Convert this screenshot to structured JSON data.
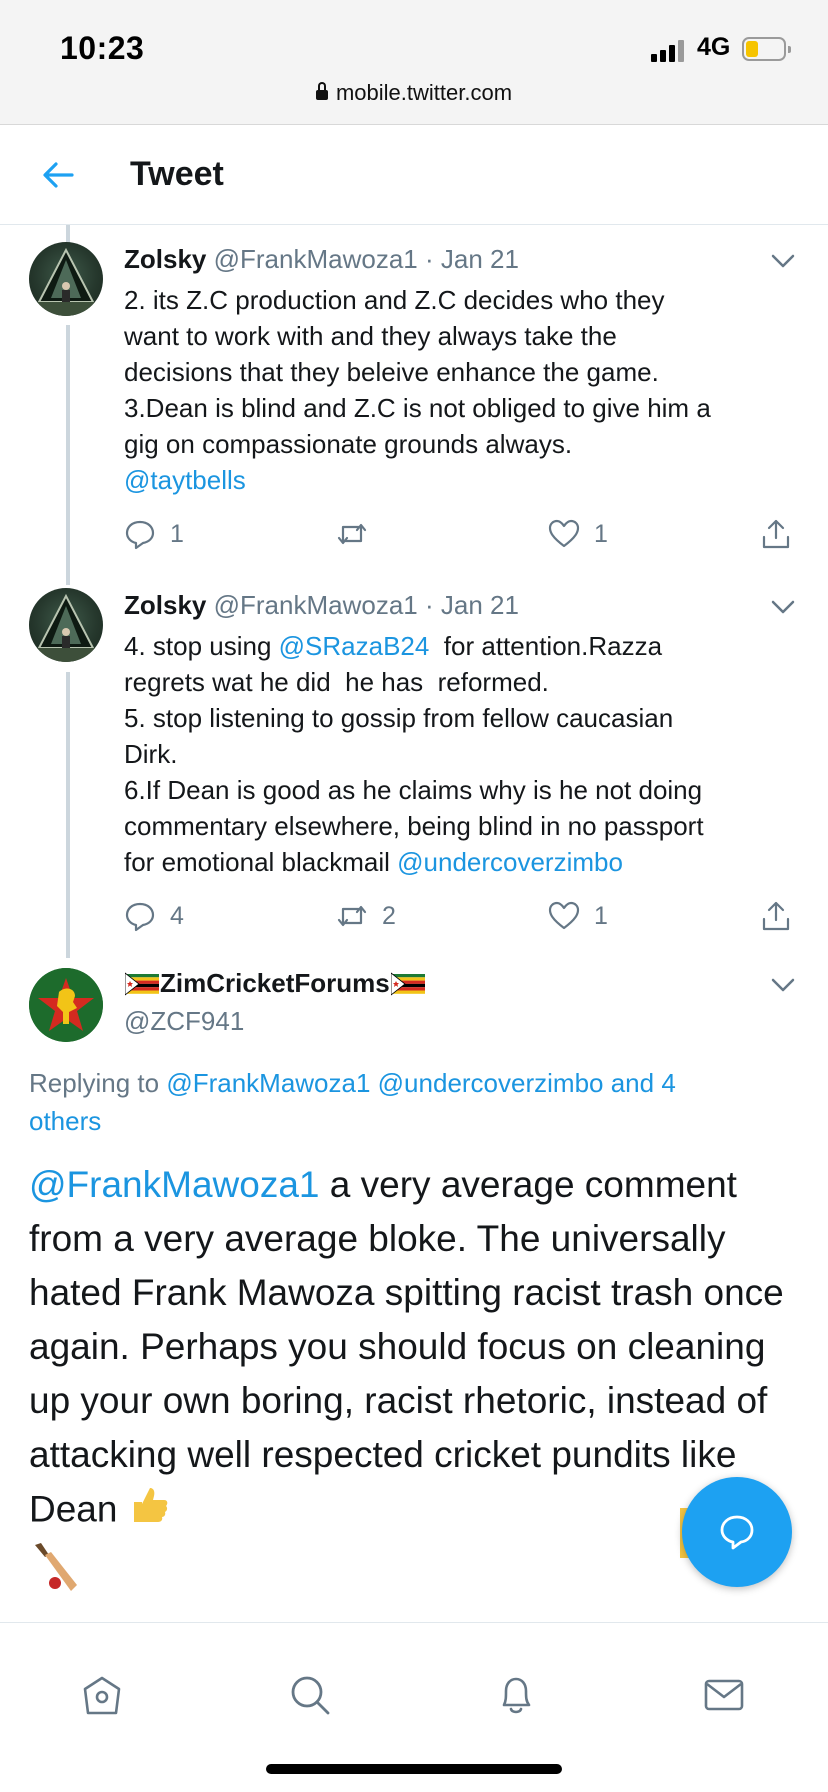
{
  "status_bar": {
    "time": "10:23",
    "network": "4G",
    "url": "mobile.twitter.com"
  },
  "header": {
    "title": "Tweet"
  },
  "tweets": [
    {
      "name": "Zolsky",
      "handle": "@FrankMawoza1",
      "separator": "·",
      "date": "Jan 21",
      "body_lines": [
        "2. its Z.C production and Z.C decides who they",
        "want to work with and they always take the",
        "decisions that they beleive enhance the game.",
        "3.Dean is blind and Z.C is not obliged to give him a",
        "gig on compassionate grounds always."
      ],
      "mention": "@taytbells",
      "replies": "1",
      "retweets": "",
      "likes": "1"
    },
    {
      "name": "Zolsky",
      "handle": "@FrankMawoza1",
      "separator": "·",
      "date": "Jan 21",
      "line1_pre": "4. stop using ",
      "line1_mention": "@SRazaB24",
      "line1_post": "  for attention.Razza",
      "body_mid": "regrets wat he did  he has  reformed.\n5. stop listening to gossip from fellow caucasian\nDirk.\n6.If Dean is good as he claims why is he not doing\ncommentary elsewhere, being blind in no passport",
      "last_pre": "for emotional blackmail ",
      "last_mention": "@undercoverzimbo",
      "replies": "4",
      "retweets": "2",
      "likes": "1"
    }
  ],
  "main_tweet": {
    "name": "ZimCricketForums",
    "handle": "@ZCF941",
    "replying_prefix": "Replying to ",
    "replying_mentions": "@FrankMawoza1 @undercoverzimbo and 4 others",
    "mention": "@FrankMawoza1",
    "text": " a very average comment from a very average bloke. The universally hated Frank Mawoza spitting racist trash once again. Perhaps you should focus on cleaning up your own boring, racist rhetoric, instead of attacking well respected cricket pundits like Dean "
  },
  "icons": {
    "back": "arrow-left-icon",
    "reply": "reply-icon",
    "retweet": "retweet-icon",
    "like": "heart-icon",
    "share": "share-icon",
    "fab": "compose-reply-icon",
    "nav": [
      "home-icon",
      "search-icon",
      "bell-icon",
      "mail-icon"
    ]
  },
  "colors": {
    "accent": "#1da1f2",
    "mention": "#1b95e0",
    "muted": "#657786"
  }
}
